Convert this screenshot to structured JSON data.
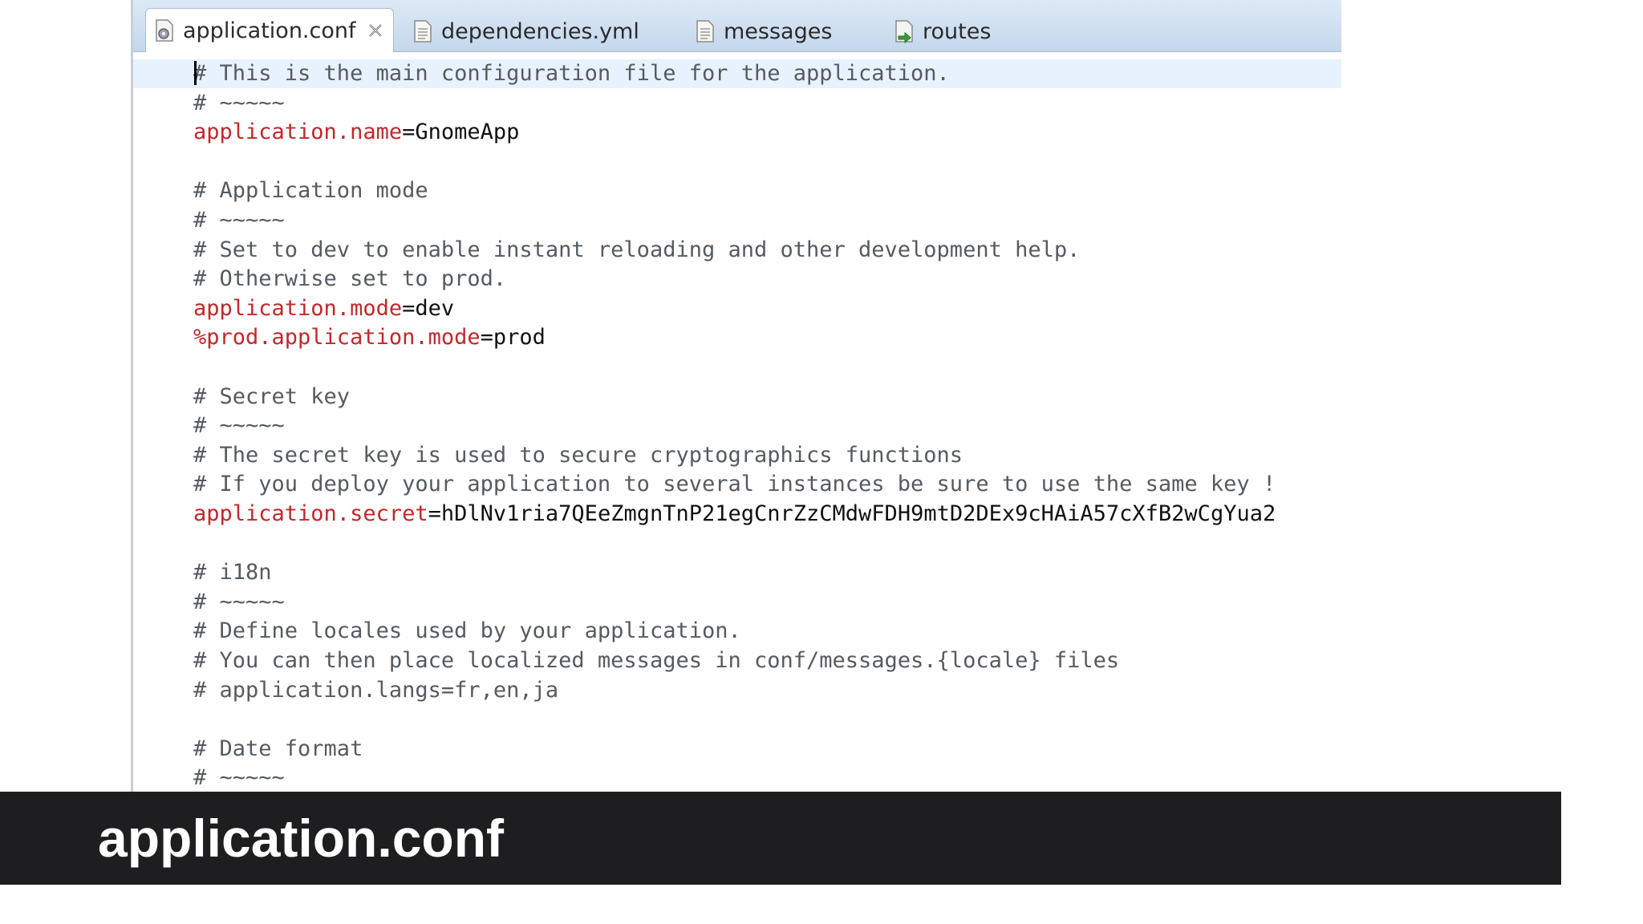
{
  "tabs": [
    {
      "label": "application.conf",
      "icon": "config-file-icon",
      "active": true
    },
    {
      "label": "dependencies.yml",
      "icon": "text-file-icon"
    },
    {
      "label": "messages",
      "icon": "text-file-icon"
    },
    {
      "label": "routes",
      "icon": "routes-file-icon"
    }
  ],
  "editor": {
    "lines": [
      {
        "type": "comment",
        "text": "# This is the main configuration file for the application."
      },
      {
        "type": "comment",
        "text": "# ~~~~~"
      },
      {
        "type": "prop",
        "key": "application.name",
        "eq": "=",
        "value": "GnomeApp"
      },
      {
        "type": "blank",
        "text": ""
      },
      {
        "type": "comment",
        "text": "# Application mode"
      },
      {
        "type": "comment",
        "text": "# ~~~~~"
      },
      {
        "type": "comment",
        "text": "# Set to dev to enable instant reloading and other development help."
      },
      {
        "type": "comment",
        "text": "# Otherwise set to prod."
      },
      {
        "type": "prop",
        "key": "application.mode",
        "eq": "=",
        "value": "dev"
      },
      {
        "type": "prop",
        "key": "%prod.application.mode",
        "eq": "=",
        "value": "prod"
      },
      {
        "type": "blank",
        "text": ""
      },
      {
        "type": "comment",
        "text": "# Secret key"
      },
      {
        "type": "comment",
        "text": "# ~~~~~"
      },
      {
        "type": "comment",
        "text": "# The secret key is used to secure cryptographics functions"
      },
      {
        "type": "comment",
        "text": "# If you deploy your application to several instances be sure to use the same key !"
      },
      {
        "type": "prop",
        "key": "application.secret",
        "eq": "=",
        "value": "hDlNv1ria7QEeZmgnTnP21egCnrZzCMdwFDH9mtD2DEx9cHAiA57cXfB2wCgYua2"
      },
      {
        "type": "blank",
        "text": ""
      },
      {
        "type": "comment",
        "text": "# i18n"
      },
      {
        "type": "comment",
        "text": "# ~~~~~"
      },
      {
        "type": "comment",
        "text": "# Define locales used by your application."
      },
      {
        "type": "comment",
        "text": "# You can then place localized messages in conf/messages.{locale} files"
      },
      {
        "type": "comment",
        "text": "# application.langs=fr,en,ja"
      },
      {
        "type": "blank",
        "text": ""
      },
      {
        "type": "comment",
        "text": "# Date format"
      },
      {
        "type": "comment",
        "text": "# ~~~~~"
      }
    ]
  },
  "caption": {
    "text": "application.conf"
  },
  "colors": {
    "key": "#c0282c",
    "comment": "#555b61",
    "caption_bg": "#1e1e20",
    "current_line": "#e8f2fe"
  }
}
